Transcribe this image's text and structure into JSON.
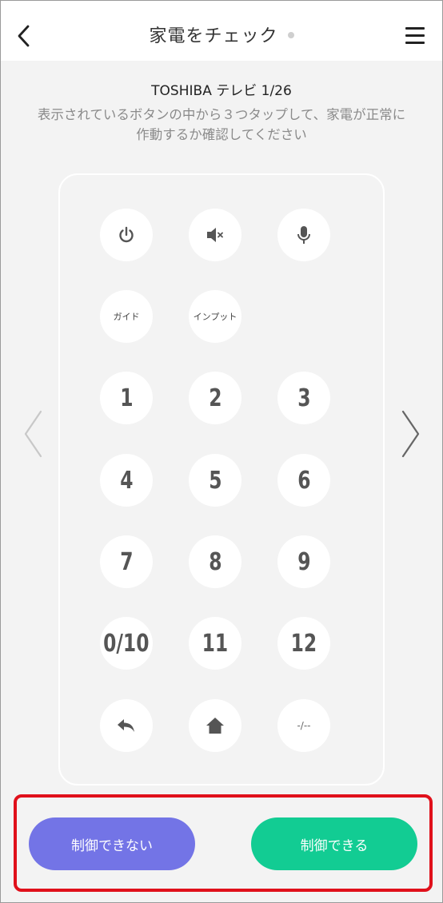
{
  "header": {
    "title": "家電をチェック",
    "back_icon": "chevron-left-icon",
    "menu_icon": "hamburger-menu-icon"
  },
  "device": {
    "name": "TOSHIBA テレビ 1/26"
  },
  "instruction": "表示されているボタンの中から３つタップして、家電が正常に作動するか確認してください",
  "remote": {
    "icons": [
      "power-icon",
      "mute-icon",
      "microphone-icon",
      "back-icon",
      "home-icon"
    ],
    "labels": {
      "guide": "ガイド",
      "input": "インプット",
      "dash": "-/--"
    },
    "numbers": [
      "1",
      "2",
      "3",
      "4",
      "5",
      "6",
      "7",
      "8",
      "9",
      "0/10",
      "11",
      "12"
    ]
  },
  "nav": {
    "prev_icon": "chevron-left-icon",
    "next_icon": "chevron-right-icon"
  },
  "actions": {
    "cannot_control": "制御できない",
    "can_control": "制御できる"
  },
  "colors": {
    "cannot_button": "#7374e6",
    "can_button": "#12cc93",
    "highlight_border": "#e0101b"
  }
}
